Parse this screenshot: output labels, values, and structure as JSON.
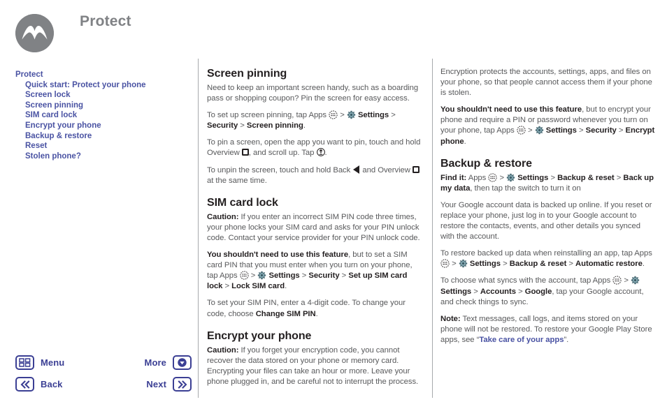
{
  "header": {
    "title": "Protect",
    "logo_icon": "motorola-logo-icon"
  },
  "sidebar": {
    "items": [
      {
        "label": "Protect",
        "level": 0
      },
      {
        "label": "Quick start: Protect your phone",
        "level": 1
      },
      {
        "label": "Screen lock",
        "level": 1
      },
      {
        "label": "Screen pinning",
        "level": 1
      },
      {
        "label": "SIM card lock",
        "level": 1
      },
      {
        "label": "Encrypt your phone",
        "level": 1
      },
      {
        "label": "Backup & restore",
        "level": 1
      },
      {
        "label": "Reset",
        "level": 1
      },
      {
        "label": "Stolen phone?",
        "level": 1
      }
    ]
  },
  "middle_column": {
    "screen_pinning": {
      "heading": "Screen pinning",
      "p1": "Need to keep an important screen handy, such as a boarding pass or shopping coupon? Pin the screen for easy access.",
      "p2_a": "To set up screen pinning, tap Apps ",
      "p2_b": " > ",
      "p2_c": "Settings",
      "p2_d": " > ",
      "p2_e": "Security",
      "p2_f": " > ",
      "p2_g": "Screen pinning",
      "p2_h": ".",
      "p3_a": "To pin a screen, open the app you want to pin, touch and hold Overview ",
      "p3_b": ", and scroll up. Tap ",
      "p3_c": ".",
      "p4_a": "To unpin the screen, touch and hold Back ",
      "p4_b": " and Overview ",
      "p4_c": " at the same time."
    },
    "sim_card_lock": {
      "heading": "SIM card lock",
      "p1_label": "Caution:",
      "p1_text": " If you enter an incorrect SIM PIN code three times, your phone locks your SIM card and asks for your PIN unlock code. Contact your service provider for your PIN unlock code.",
      "p2_bold": "You shouldn't need to use this feature",
      "p2_a": ", but to set a SIM card PIN that you must enter when you turn on your phone, tap Apps ",
      "p2_b": " > ",
      "p2_c": "Settings",
      "p2_d": " > ",
      "p2_e": "Security",
      "p2_f": " > ",
      "p2_g": "Set up SIM card lock",
      "p2_h": " > ",
      "p2_i": "Lock SIM card",
      "p2_j": ".",
      "p3_a": "To set your SIM PIN, enter a 4-digit code. To change your code, choose ",
      "p3_b": "Change SIM PIN",
      "p3_c": "."
    },
    "encrypt_your_phone": {
      "heading": "Encrypt your phone",
      "p1_label": "Caution:",
      "p1_text": " If you forget your encryption code, you cannot recover the data stored on your phone or memory card. Encrypting your files can take an hour or more. Leave your phone plugged in, and be careful not to interrupt the process."
    }
  },
  "right_column": {
    "encrypt_cont": {
      "p1": "Encryption protects the accounts, settings, apps, and files on your phone, so that people cannot access them if your phone is stolen.",
      "p2_bold": "You shouldn't need to use this feature",
      "p2_a": ", but to encrypt your phone and require a PIN or password whenever you turn on your phone, tap Apps ",
      "p2_b": " > ",
      "p2_c": "Settings",
      "p2_d": " > ",
      "p2_e": "Security",
      "p2_f": " > ",
      "p2_g": "Encrypt phone",
      "p2_h": "."
    },
    "backup_restore": {
      "heading": "Backup & restore",
      "findit_label": "Find it:",
      "findit_a": " Apps ",
      "findit_b": " > ",
      "findit_c": "Settings",
      "findit_d": " > ",
      "findit_e": "Backup & reset",
      "findit_f": " > ",
      "findit_g": "Back up my data",
      "findit_h": ", then tap the switch to turn it on",
      "p1": "Your Google account data is backed up online. If you reset or replace your phone, just log in to your Google account to restore the contacts, events, and other details you synced with the account.",
      "p2_a": "To restore backed up data when reinstalling an app, tap Apps ",
      "p2_b": " > ",
      "p2_c": "Settings",
      "p2_d": " > ",
      "p2_e": "Backup & reset",
      "p2_f": " > ",
      "p2_g": "Automatic restore",
      "p2_h": ".",
      "p3_a": "To choose what syncs with the account, tap Apps ",
      "p3_b": " > ",
      "p3_c": "Settings",
      "p3_d": " > ",
      "p3_e": "Accounts",
      "p3_f": " > ",
      "p3_g": "Google",
      "p3_h": ", tap your Google account, and check things to sync.",
      "note_label": "Note:",
      "note_a": " Text messages, call logs, and items stored on your phone will not be restored. To restore your Google Play Store apps, see “",
      "note_link": "Take care of your apps",
      "note_b": "”."
    }
  },
  "bottom_nav": {
    "menu_label": "Menu",
    "menu_icon": "grid-menu-icon",
    "back_label": "Back",
    "back_icon": "double-chevron-left-icon",
    "more_label": "More",
    "more_icon": "chevron-down-circle-icon",
    "next_label": "Next",
    "next_icon": "double-chevron-right-icon"
  },
  "colors": {
    "link": "#4a53a3",
    "nav": "#3b3f94",
    "logo_gray": "#808285",
    "body_text": "#58595b",
    "bold_text": "#231f20",
    "gear_teal": "#3f8d9c"
  }
}
